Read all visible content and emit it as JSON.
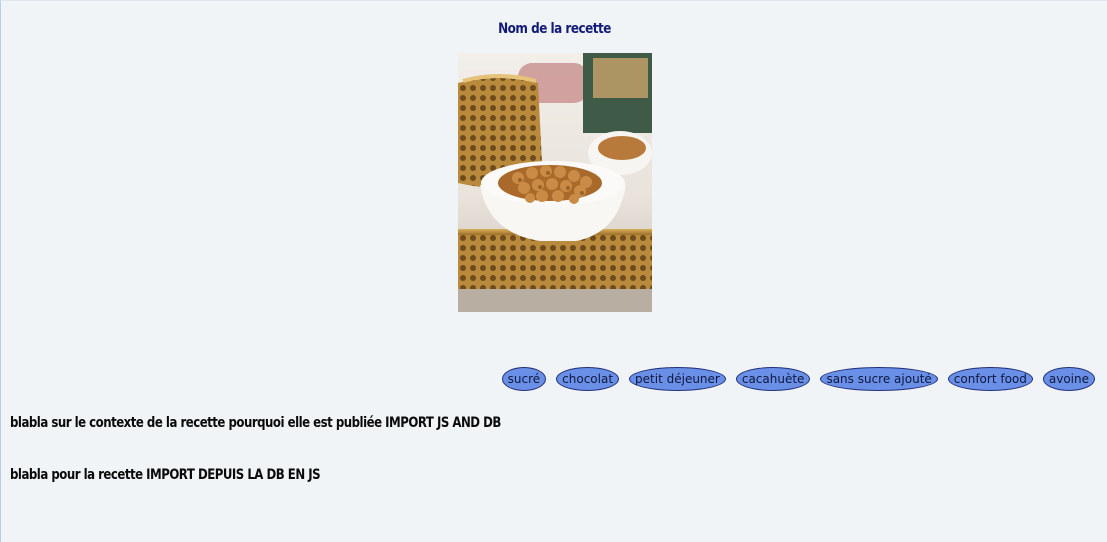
{
  "recipe": {
    "title": "Nom de la recette",
    "context_text": "blabla sur le contexte de la recette pourquoi elle est publiée IMPORT JS AND DB",
    "body_text": "blabla pour la recette IMPORT DEPUIS LA DB EN JS"
  },
  "tags": [
    "sucré",
    "chocolat",
    "petit déjeuner",
    "cacahuète",
    "sans sucre ajouté",
    "confort food",
    "avoine"
  ],
  "colors": {
    "background": "#f1f4f6",
    "title": "#111a78",
    "tag_fill": "#6a8fe6",
    "tag_border": "#1f2f7a"
  }
}
